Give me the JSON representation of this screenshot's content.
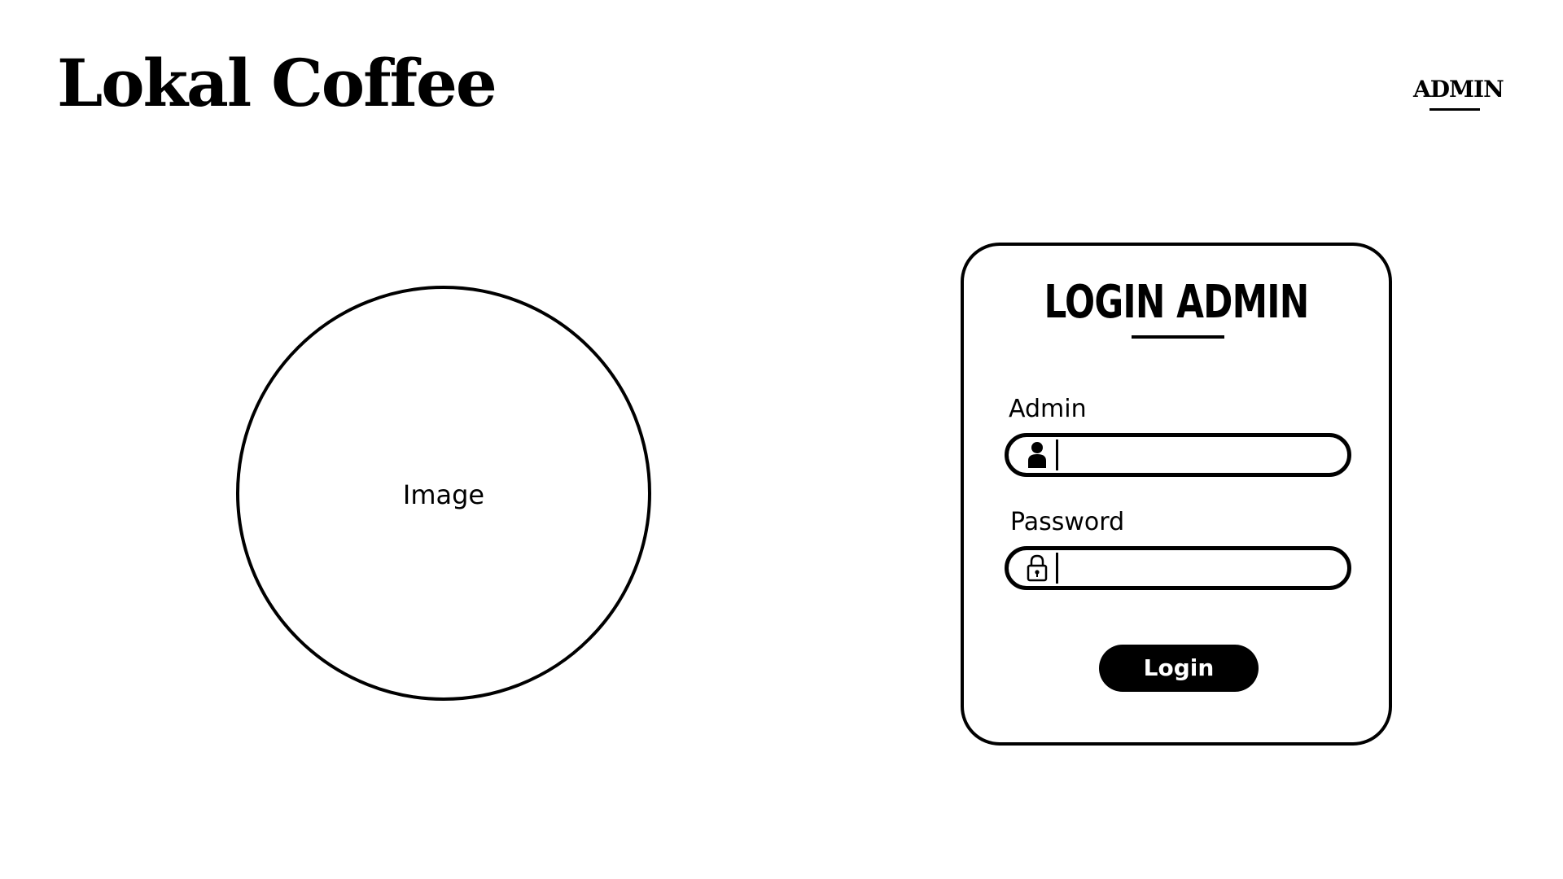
{
  "header": {
    "brand": "Lokal Coffee",
    "nav_admin": "ADMIN"
  },
  "hero": {
    "image_label": "Image"
  },
  "login": {
    "title": "LOGIN ADMIN",
    "admin_label": "Admin",
    "admin_value": "",
    "admin_placeholder": "",
    "admin_icon": "user-icon",
    "password_label": "Password",
    "password_value": "",
    "password_placeholder": "",
    "password_icon": "lock-icon",
    "submit_label": "Login"
  },
  "colors": {
    "foreground": "#000000",
    "background": "#ffffff",
    "button_text": "#ffffff"
  }
}
